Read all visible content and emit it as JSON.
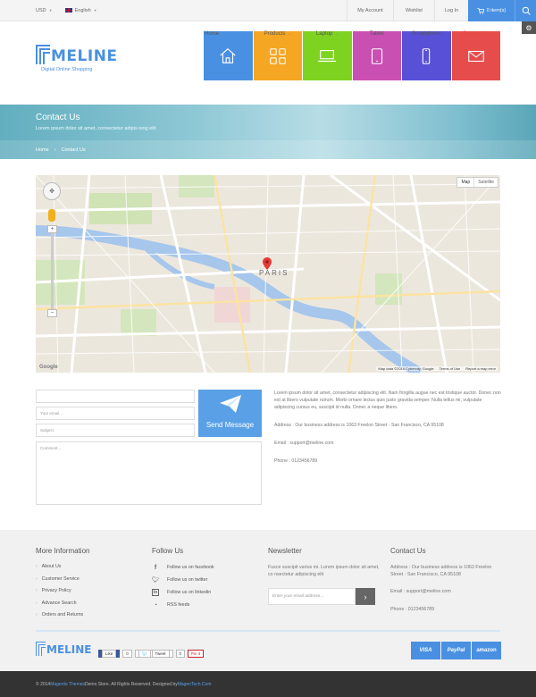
{
  "topbar": {
    "currency": "USD",
    "language": "English",
    "my_account": "My Account",
    "wishlist": "Wishlist",
    "login": "Log In",
    "cart": "0 item(s)"
  },
  "logo": {
    "name": "MELINE",
    "tagline": "Digital Online Shopping"
  },
  "nav": [
    {
      "label": "Home",
      "color": "#4a90e2",
      "icon": "home-icon",
      "has_caret": true
    },
    {
      "label": "Products",
      "color": "#f5a623",
      "icon": "grid-icon",
      "has_caret": true
    },
    {
      "label": "Laptop",
      "color": "#7ed321",
      "icon": "laptop-icon",
      "has_caret": true
    },
    {
      "label": "Tablet",
      "color": "#c94fb3",
      "icon": "tablet-icon",
      "has_caret": false
    },
    {
      "label": "Smartphone",
      "color": "#5850d6",
      "icon": "smartphone-icon",
      "has_caret": false
    },
    {
      "label": "Contact Us",
      "color": "#e74c4c",
      "icon": "mail-icon",
      "has_caret": false
    }
  ],
  "banner": {
    "title": "Contact Us",
    "subtitle": "Lorem ipsum dolor sit amet, consectetur adipis iong elit",
    "breadcrumb": [
      "Home",
      "Contact Us"
    ]
  },
  "map": {
    "type_map": "Map",
    "type_satellite": "Satellite",
    "city_label": "PARIS",
    "attribution": "Map data ©2014 Cybercity, Google",
    "terms": "Terms of Use",
    "report": "Report a map error",
    "google": "Google"
  },
  "form": {
    "name_placeholder": "",
    "email_placeholder": "Your email...",
    "subject_placeholder": "Subject",
    "comment_placeholder": "Comment...",
    "send_label": "Send Message"
  },
  "contact_info": {
    "intro": "Lorem ipsum dolor sit amet, consectetur adipiscing elit. Nam fringilla augue nec est tristique auctor. Donec non est at libero vulputate rutrum. Morbi ornare lectus quis justo gravida semper. Nulla tellus mi, vulputate adipiscing cursus eu, suscipit id nulla. Donec a neque libero.",
    "address": "Address : Our business address is 1063 Freelon Street - San Francisco, CA 95108",
    "email": "Email : support@meline.com",
    "phone": "Phone : 0123456789"
  },
  "footer": {
    "more_info_title": "More Information",
    "more_info_links": [
      "About Us",
      "Customer Service",
      "Privacy Policy",
      "Advance Search",
      "Orders and Returns"
    ],
    "follow_title": "Follow Us",
    "follow_links": [
      {
        "label": "Follow us on facebook",
        "icon": "facebook-icon"
      },
      {
        "label": "Follow us on twitter",
        "icon": "twitter-icon"
      },
      {
        "label": "Follow us on linkedin",
        "icon": "linkedin-icon"
      },
      {
        "label": "RSS feeds",
        "icon": "rss-icon"
      }
    ],
    "newsletter_title": "Newsletter",
    "newsletter_text": "Fusce suscipit varius mi. Lorem ipsum dolor sit amet, co nsectetur adipiscing elit",
    "newsletter_placeholder": "Enter your email address...",
    "contact_title": "Contact Us",
    "contact_address": "Address : Our business address is 1063 Freelon Street - San Francisco, CA 95108",
    "contact_email": "Email : support@meline.com",
    "contact_phone": "Phone : 0123456789",
    "social": {
      "like": "Like",
      "like_count": "0",
      "tweet": "Tweet",
      "tweet_count": "0",
      "pin": "Pin it"
    },
    "payments": [
      "VISA",
      "PayPal",
      "amazon"
    ],
    "copyright_pre": "© 2014 ",
    "copyright_brand": "Magento Themes",
    "copyright_mid": " Demo Store. All Rights Reserved. Designed by ",
    "copyright_designer": "MagenTech.Com"
  }
}
